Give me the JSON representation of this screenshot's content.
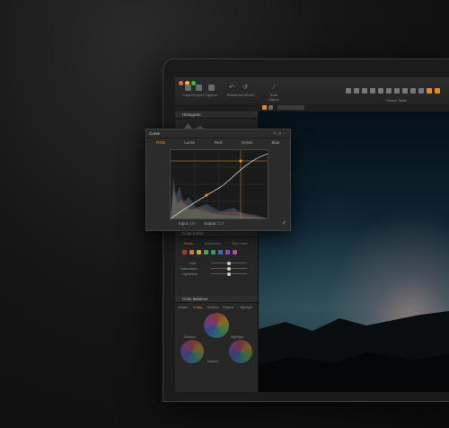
{
  "toolbar": {
    "buttons": [
      {
        "label": "Import"
      },
      {
        "label": "Export"
      },
      {
        "label": "Capture"
      },
      {
        "label": "Reset"
      },
      {
        "label": "Undo/Redo"
      },
      {
        "label": "Auto Adjust"
      }
    ],
    "cursor_tools_label": "Cursor Tools"
  },
  "histogram": {
    "title": "Histogram"
  },
  "curves": {
    "title": "Curve",
    "tabs": [
      {
        "label": "RGB",
        "active": true
      },
      {
        "label": "Luma"
      },
      {
        "label": "Red"
      },
      {
        "label": "Green"
      },
      {
        "label": "Blue"
      }
    ],
    "input_label": "Input",
    "input_value": "135",
    "output_label": "Output",
    "output_value": "223"
  },
  "color_editor": {
    "title": "Color Editor",
    "tabs": [
      "Basic",
      "Advanced",
      "Skin Tone"
    ],
    "sliders": [
      "Hue",
      "Saturation",
      "Lightness"
    ]
  },
  "color_balance": {
    "title": "Color Balance",
    "tabs": [
      "Master",
      "3-Way",
      "Shadow",
      "Midtone",
      "Highlight"
    ],
    "wheel_labels": [
      "Shadow",
      "Midtone",
      "Highlight"
    ]
  },
  "colors": {
    "accent": "#e08a2b",
    "swatches": [
      "#c0392b",
      "#d9822b",
      "#c9b52d",
      "#4caf50",
      "#2e9c8f",
      "#3a6fcf",
      "#7b4fcf",
      "#c44ea5"
    ]
  }
}
